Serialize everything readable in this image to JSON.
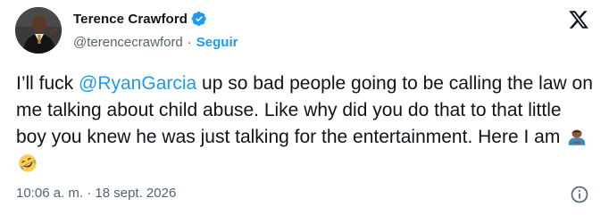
{
  "author": {
    "display_name": "Terence Crawford",
    "handle": "@terencecrawford",
    "separator": "·",
    "follow_label": "Seguir",
    "verified": true
  },
  "tweet": {
    "text_before_mention": "I’ll fuck ",
    "mention": "@RyanGarcia",
    "text_after_mention": " up so bad people going to be calling the law on me talking about child abuse. Like why did you do that to that little boy you knew he was just talking for the entertainment. Here I am ",
    "emojis": [
      "person-bowing-icon",
      "rolling-on-floor-laughing-icon"
    ]
  },
  "footer": {
    "timestamp": "10:06 a. m. · 18 sept. 2026",
    "info_icon": "info-icon"
  },
  "brand": {
    "logo": "x-logo-icon"
  },
  "colors": {
    "text": "#0f1419",
    "secondary": "#536471",
    "accent": "#1d9bf0"
  }
}
